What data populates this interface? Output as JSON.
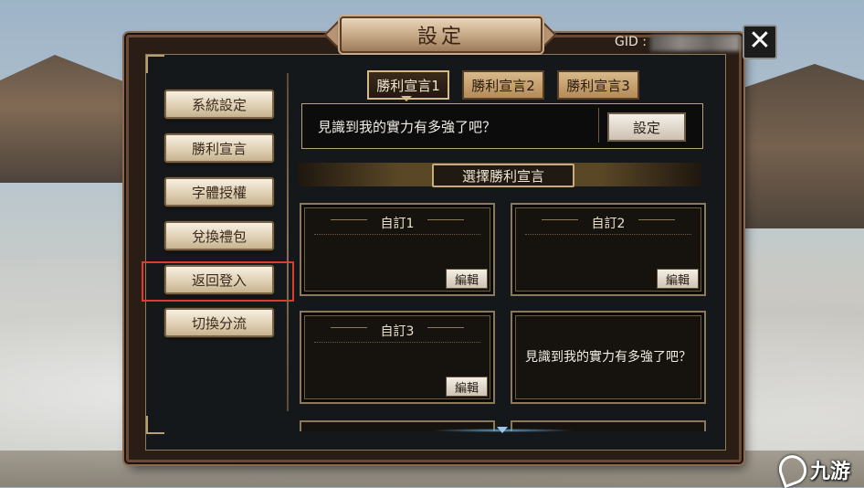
{
  "dialog": {
    "title": "設定",
    "gid_label": "GID :"
  },
  "close": {
    "glyph": "✕"
  },
  "menu": [
    {
      "label": "系統設定"
    },
    {
      "label": "勝利宣言"
    },
    {
      "label": "字體授權"
    },
    {
      "label": "兌換禮包"
    },
    {
      "label": "返回登入"
    },
    {
      "label": "切換分流"
    }
  ],
  "tabs": [
    {
      "label": "勝利宣言1",
      "active": true
    },
    {
      "label": "勝利宣言2",
      "active": false
    },
    {
      "label": "勝利宣言3",
      "active": false
    }
  ],
  "current_quote": {
    "text": "見識到我的實力有多強了吧？",
    "set_label": "設定"
  },
  "section": {
    "label": "選擇勝利宣言"
  },
  "cards": [
    {
      "title": "自訂1",
      "edit_label": "編輯"
    },
    {
      "title": "自訂2",
      "edit_label": "編輯"
    },
    {
      "title": "自訂3",
      "edit_label": "編輯"
    },
    {
      "body": "見識到我的實力有多強了吧？"
    }
  ],
  "watermark": {
    "text": "九游"
  },
  "colors": {
    "highlight": "#e03a2e",
    "accent_gold": "#c8ab78",
    "scroll_indicator": "#9ec7e8"
  }
}
